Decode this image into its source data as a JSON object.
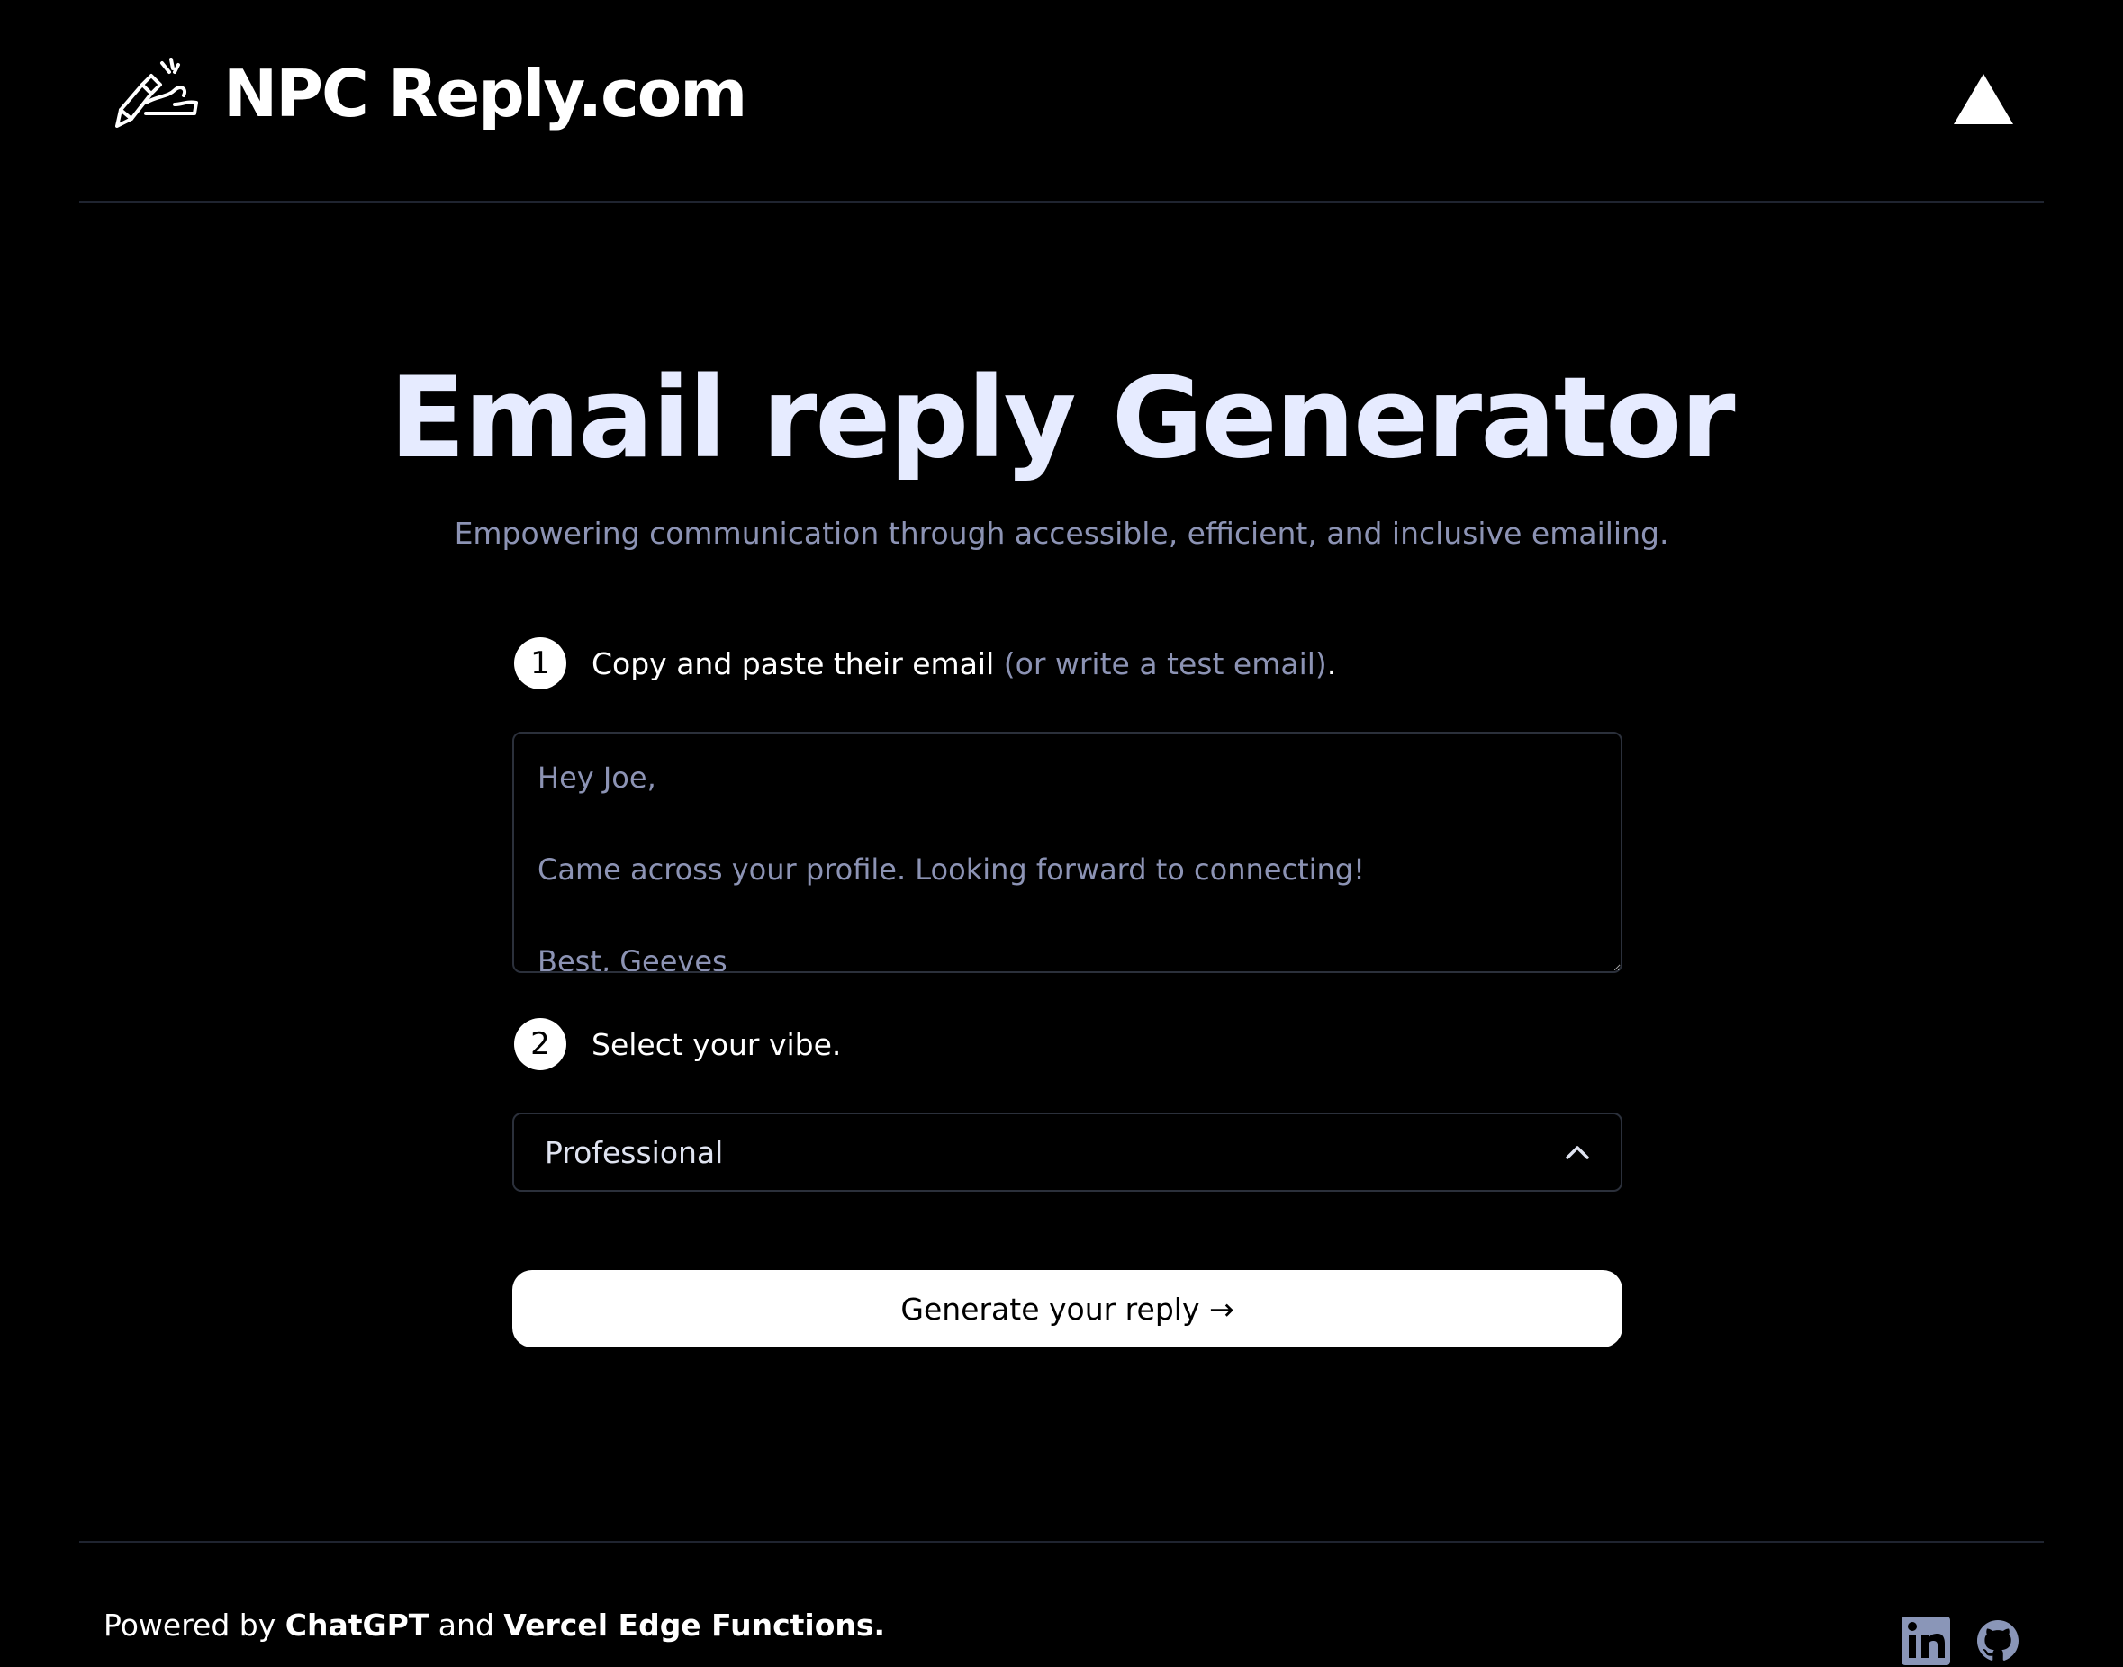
{
  "header": {
    "brand_name": "NPC Reply.com",
    "brand_icon": "writing-hand-icon",
    "right_icon": "vercel-triangle-icon"
  },
  "hero": {
    "title": "Email reply Generator",
    "subtitle": "Empowering communication through accessible, efficient, and inclusive emailing."
  },
  "form": {
    "step1": {
      "number": "1",
      "label": "Copy and paste their email ",
      "hint": "(or write a test email)",
      "suffix": "."
    },
    "email_placeholder": "Hey Joe,\n\nCame across your profile. Looking forward to connecting!\n\nBest, Geeves",
    "step2": {
      "number": "2",
      "label": "Select your vibe."
    },
    "vibe_selected": "Professional",
    "generate_label": "Generate your reply →"
  },
  "footer": {
    "powered_prefix": "Powered by ",
    "chatgpt": "ChatGPT",
    "and": " and ",
    "vercel": "Vercel Edge Functions.",
    "social_icons": [
      "linkedin-icon",
      "github-icon"
    ]
  },
  "colors": {
    "background": "#000000",
    "title": "#e6ebff",
    "muted": "#8c93b4",
    "border": "#2b303b",
    "social_icon": "#8a96b8"
  }
}
